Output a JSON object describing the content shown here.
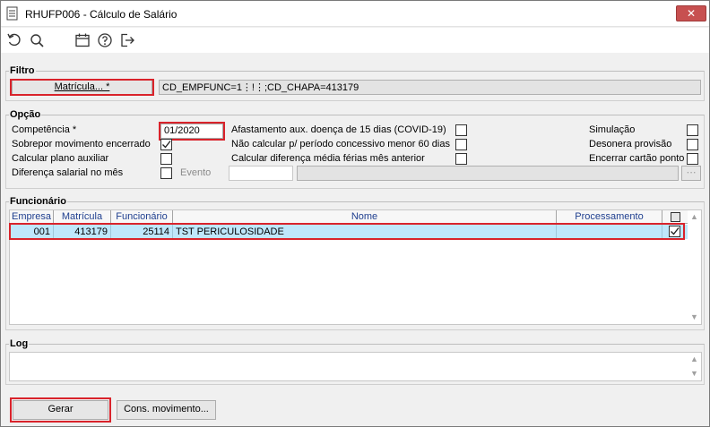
{
  "window": {
    "title": "RHUFP006 - Cálculo de Salário",
    "close_label": "✕"
  },
  "toolbar": {
    "icons": [
      "refresh-icon",
      "search-icon",
      "calendar-icon",
      "help-icon",
      "exit-icon"
    ]
  },
  "filtro": {
    "legend": "Filtro",
    "matricula_button": "Matrícula... *",
    "filter_value": "CD_EMPFUNC=1⋮!⋮;CD_CHAPA=413179"
  },
  "opcao": {
    "legend": "Opção",
    "competencia_label": "Competência *",
    "competencia_value": "01/2020",
    "sobrepor_label": "Sobrepor movimento encerrado",
    "sobrepor_checked": true,
    "calcular_plano_label": "Calcular plano auxiliar",
    "calcular_plano_checked": false,
    "diferenca_salarial_label": "Diferença salarial no mês",
    "diferenca_salarial_checked": false,
    "evento_label": "Evento",
    "evento_value": "",
    "evento_desc": "",
    "evento_lookup_label": "⋯",
    "afastamento_label": "Afastamento aux. doença de 15 dias (COVID-19)",
    "afastamento_checked": false,
    "nao_calcular_label": "Não calcular p/ período concessivo menor 60 dias",
    "nao_calcular_checked": false,
    "calcular_diferenca_label": "Calcular diferença média férias mês anterior",
    "calcular_diferenca_checked": false,
    "simulacao_label": "Simulação",
    "simulacao_checked": false,
    "desonera_label": "Desonera provisão",
    "desonera_checked": false,
    "encerrar_label": "Encerrar cartão ponto",
    "encerrar_checked": false
  },
  "funcionario": {
    "legend": "Funcionário",
    "columns": [
      "Empresa",
      "Matrícula",
      "Funcionário",
      "Nome",
      "Processamento"
    ],
    "rows": [
      {
        "empresa": "001",
        "matricula": "413179",
        "funcionario": "25114",
        "nome": "TST PERICULOSIDADE",
        "processamento": "",
        "selected": true
      }
    ]
  },
  "log": {
    "legend": "Log",
    "text": ""
  },
  "buttons": {
    "gerar": "Gerar",
    "cons_movimento": "Cons. movimento..."
  },
  "colors": {
    "highlight_red": "#d9232b",
    "row_selected": "#bfe7fb",
    "header_text": "#1f3f8f"
  }
}
